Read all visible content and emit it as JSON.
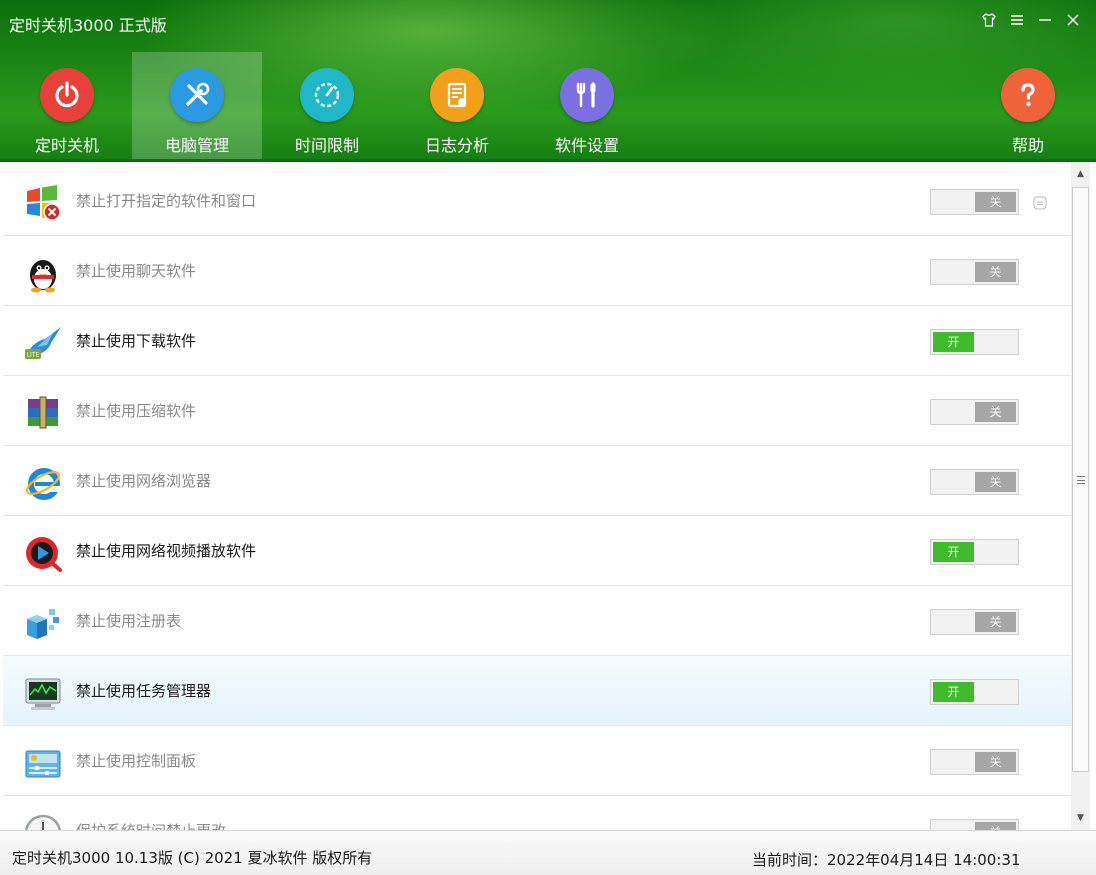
{
  "window": {
    "title": "定时关机3000 正式版",
    "controls": [
      "skin-icon",
      "menu-icon",
      "minimize-icon",
      "close-icon"
    ]
  },
  "nav": {
    "tabs": [
      {
        "label": "定时关机",
        "icon": "power-icon",
        "color": "#e8403a"
      },
      {
        "label": "电脑管理",
        "icon": "tools-icon",
        "color": "#2a9be0",
        "active": true
      },
      {
        "label": "时间限制",
        "icon": "timer-icon",
        "color": "#20b7c9"
      },
      {
        "label": "日志分析",
        "icon": "log-icon",
        "color": "#f2a019"
      },
      {
        "label": "软件设置",
        "icon": "settings-tools-icon",
        "color": "#7b6fe2"
      }
    ],
    "help": {
      "label": "帮助",
      "icon": "help-icon",
      "color": "#f0623a"
    }
  },
  "rows": [
    {
      "label": "禁止打开指定的软件和窗口",
      "icon": "windows-block-icon",
      "state": "关",
      "on": false,
      "extra": true
    },
    {
      "label": "禁止使用聊天软件",
      "icon": "qq-penguin-icon",
      "state": "关",
      "on": false
    },
    {
      "label": "禁止使用下载软件",
      "icon": "thunder-bird-icon",
      "state": "开",
      "on": true
    },
    {
      "label": "禁止使用压缩软件",
      "icon": "winrar-icon",
      "state": "关",
      "on": false
    },
    {
      "label": "禁止使用网络浏览器",
      "icon": "ie-icon",
      "state": "关",
      "on": false
    },
    {
      "label": "禁止使用网络视频播放软件",
      "icon": "video-player-icon",
      "state": "开",
      "on": true
    },
    {
      "label": "禁止使用注册表",
      "icon": "registry-icon",
      "state": "关",
      "on": false
    },
    {
      "label": "禁止使用任务管理器",
      "icon": "task-manager-icon",
      "state": "开",
      "on": true,
      "highlight": true
    },
    {
      "label": "禁止使用控制面板",
      "icon": "control-panel-icon",
      "state": "关",
      "on": false
    },
    {
      "label": "保护系统时间禁止更改",
      "icon": "clock-icon",
      "state": "关",
      "on": false
    }
  ],
  "footer": {
    "copyright": "定时关机3000  10.13版  (C)  2021  夏冰软件 版权所有",
    "time": "当前时间：2022年04月14日 14:00:31"
  },
  "colors": {
    "toggle_on": "#3fbc2b",
    "toggle_off": "#a6a6a6",
    "header": "#1e8a16"
  }
}
